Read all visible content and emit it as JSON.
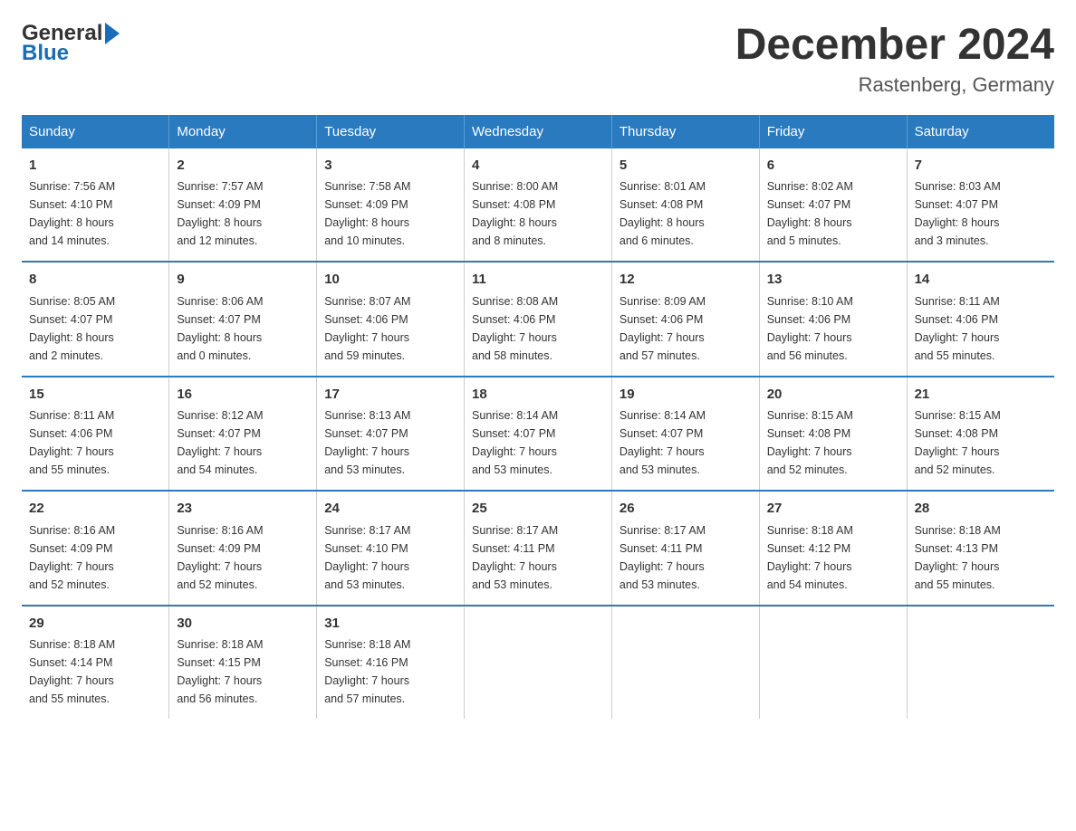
{
  "header": {
    "title": "December 2024",
    "subtitle": "Rastenberg, Germany",
    "logo_general": "General",
    "logo_blue": "Blue"
  },
  "days_of_week": [
    "Sunday",
    "Monday",
    "Tuesday",
    "Wednesday",
    "Thursday",
    "Friday",
    "Saturday"
  ],
  "weeks": [
    [
      {
        "day": "1",
        "sunrise": "7:56 AM",
        "sunset": "4:10 PM",
        "daylight": "8 hours and 14 minutes."
      },
      {
        "day": "2",
        "sunrise": "7:57 AM",
        "sunset": "4:09 PM",
        "daylight": "8 hours and 12 minutes."
      },
      {
        "day": "3",
        "sunrise": "7:58 AM",
        "sunset": "4:09 PM",
        "daylight": "8 hours and 10 minutes."
      },
      {
        "day": "4",
        "sunrise": "8:00 AM",
        "sunset": "4:08 PM",
        "daylight": "8 hours and 8 minutes."
      },
      {
        "day": "5",
        "sunrise": "8:01 AM",
        "sunset": "4:08 PM",
        "daylight": "8 hours and 6 minutes."
      },
      {
        "day": "6",
        "sunrise": "8:02 AM",
        "sunset": "4:07 PM",
        "daylight": "8 hours and 5 minutes."
      },
      {
        "day": "7",
        "sunrise": "8:03 AM",
        "sunset": "4:07 PM",
        "daylight": "8 hours and 3 minutes."
      }
    ],
    [
      {
        "day": "8",
        "sunrise": "8:05 AM",
        "sunset": "4:07 PM",
        "daylight": "8 hours and 2 minutes."
      },
      {
        "day": "9",
        "sunrise": "8:06 AM",
        "sunset": "4:07 PM",
        "daylight": "8 hours and 0 minutes."
      },
      {
        "day": "10",
        "sunrise": "8:07 AM",
        "sunset": "4:06 PM",
        "daylight": "7 hours and 59 minutes."
      },
      {
        "day": "11",
        "sunrise": "8:08 AM",
        "sunset": "4:06 PM",
        "daylight": "7 hours and 58 minutes."
      },
      {
        "day": "12",
        "sunrise": "8:09 AM",
        "sunset": "4:06 PM",
        "daylight": "7 hours and 57 minutes."
      },
      {
        "day": "13",
        "sunrise": "8:10 AM",
        "sunset": "4:06 PM",
        "daylight": "7 hours and 56 minutes."
      },
      {
        "day": "14",
        "sunrise": "8:11 AM",
        "sunset": "4:06 PM",
        "daylight": "7 hours and 55 minutes."
      }
    ],
    [
      {
        "day": "15",
        "sunrise": "8:11 AM",
        "sunset": "4:06 PM",
        "daylight": "7 hours and 55 minutes."
      },
      {
        "day": "16",
        "sunrise": "8:12 AM",
        "sunset": "4:07 PM",
        "daylight": "7 hours and 54 minutes."
      },
      {
        "day": "17",
        "sunrise": "8:13 AM",
        "sunset": "4:07 PM",
        "daylight": "7 hours and 53 minutes."
      },
      {
        "day": "18",
        "sunrise": "8:14 AM",
        "sunset": "4:07 PM",
        "daylight": "7 hours and 53 minutes."
      },
      {
        "day": "19",
        "sunrise": "8:14 AM",
        "sunset": "4:07 PM",
        "daylight": "7 hours and 53 minutes."
      },
      {
        "day": "20",
        "sunrise": "8:15 AM",
        "sunset": "4:08 PM",
        "daylight": "7 hours and 52 minutes."
      },
      {
        "day": "21",
        "sunrise": "8:15 AM",
        "sunset": "4:08 PM",
        "daylight": "7 hours and 52 minutes."
      }
    ],
    [
      {
        "day": "22",
        "sunrise": "8:16 AM",
        "sunset": "4:09 PM",
        "daylight": "7 hours and 52 minutes."
      },
      {
        "day": "23",
        "sunrise": "8:16 AM",
        "sunset": "4:09 PM",
        "daylight": "7 hours and 52 minutes."
      },
      {
        "day": "24",
        "sunrise": "8:17 AM",
        "sunset": "4:10 PM",
        "daylight": "7 hours and 53 minutes."
      },
      {
        "day": "25",
        "sunrise": "8:17 AM",
        "sunset": "4:11 PM",
        "daylight": "7 hours and 53 minutes."
      },
      {
        "day": "26",
        "sunrise": "8:17 AM",
        "sunset": "4:11 PM",
        "daylight": "7 hours and 53 minutes."
      },
      {
        "day": "27",
        "sunrise": "8:18 AM",
        "sunset": "4:12 PM",
        "daylight": "7 hours and 54 minutes."
      },
      {
        "day": "28",
        "sunrise": "8:18 AM",
        "sunset": "4:13 PM",
        "daylight": "7 hours and 55 minutes."
      }
    ],
    [
      {
        "day": "29",
        "sunrise": "8:18 AM",
        "sunset": "4:14 PM",
        "daylight": "7 hours and 55 minutes."
      },
      {
        "day": "30",
        "sunrise": "8:18 AM",
        "sunset": "4:15 PM",
        "daylight": "7 hours and 56 minutes."
      },
      {
        "day": "31",
        "sunrise": "8:18 AM",
        "sunset": "4:16 PM",
        "daylight": "7 hours and 57 minutes."
      },
      null,
      null,
      null,
      null
    ]
  ],
  "labels": {
    "sunrise": "Sunrise:",
    "sunset": "Sunset:",
    "daylight": "Daylight:"
  }
}
